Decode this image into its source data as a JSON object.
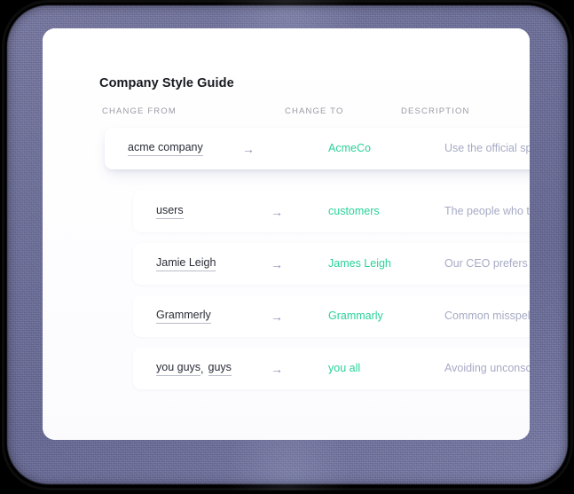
{
  "panel": {
    "title": "Company Style Guide"
  },
  "columns": {
    "change_from": "CHANGE FROM",
    "change_to": "CHANGE TO",
    "description": "DESCRIPTION"
  },
  "icons": {
    "arrow": "→"
  },
  "colors": {
    "replacement_green": "#2ad29b",
    "description_gray": "#a6abc4",
    "term_dark": "#2b2d38",
    "column_header": "#9a9aa4",
    "frame_slate": "#6f7196"
  },
  "rows": [
    {
      "terms": [
        "acme company"
      ],
      "separator": "",
      "replacement": "AcmeCo",
      "description": "Use the official spelling a",
      "elevated": true
    },
    {
      "terms": [
        "users"
      ],
      "separator": "",
      "replacement": "customers",
      "description": "The people who ta",
      "elevated": false
    },
    {
      "terms": [
        "Jamie Leigh"
      ],
      "separator": "",
      "replacement": "James Leigh",
      "description": "Our CEO prefers th",
      "elevated": false
    },
    {
      "terms": [
        "Grammerly"
      ],
      "separator": "",
      "replacement": "Grammarly",
      "description": "Common misspellin",
      "elevated": false
    },
    {
      "terms": [
        "you guys",
        "guys"
      ],
      "separator": ",",
      "replacement": "you all",
      "description": "Avoiding unconscio",
      "elevated": false
    }
  ]
}
